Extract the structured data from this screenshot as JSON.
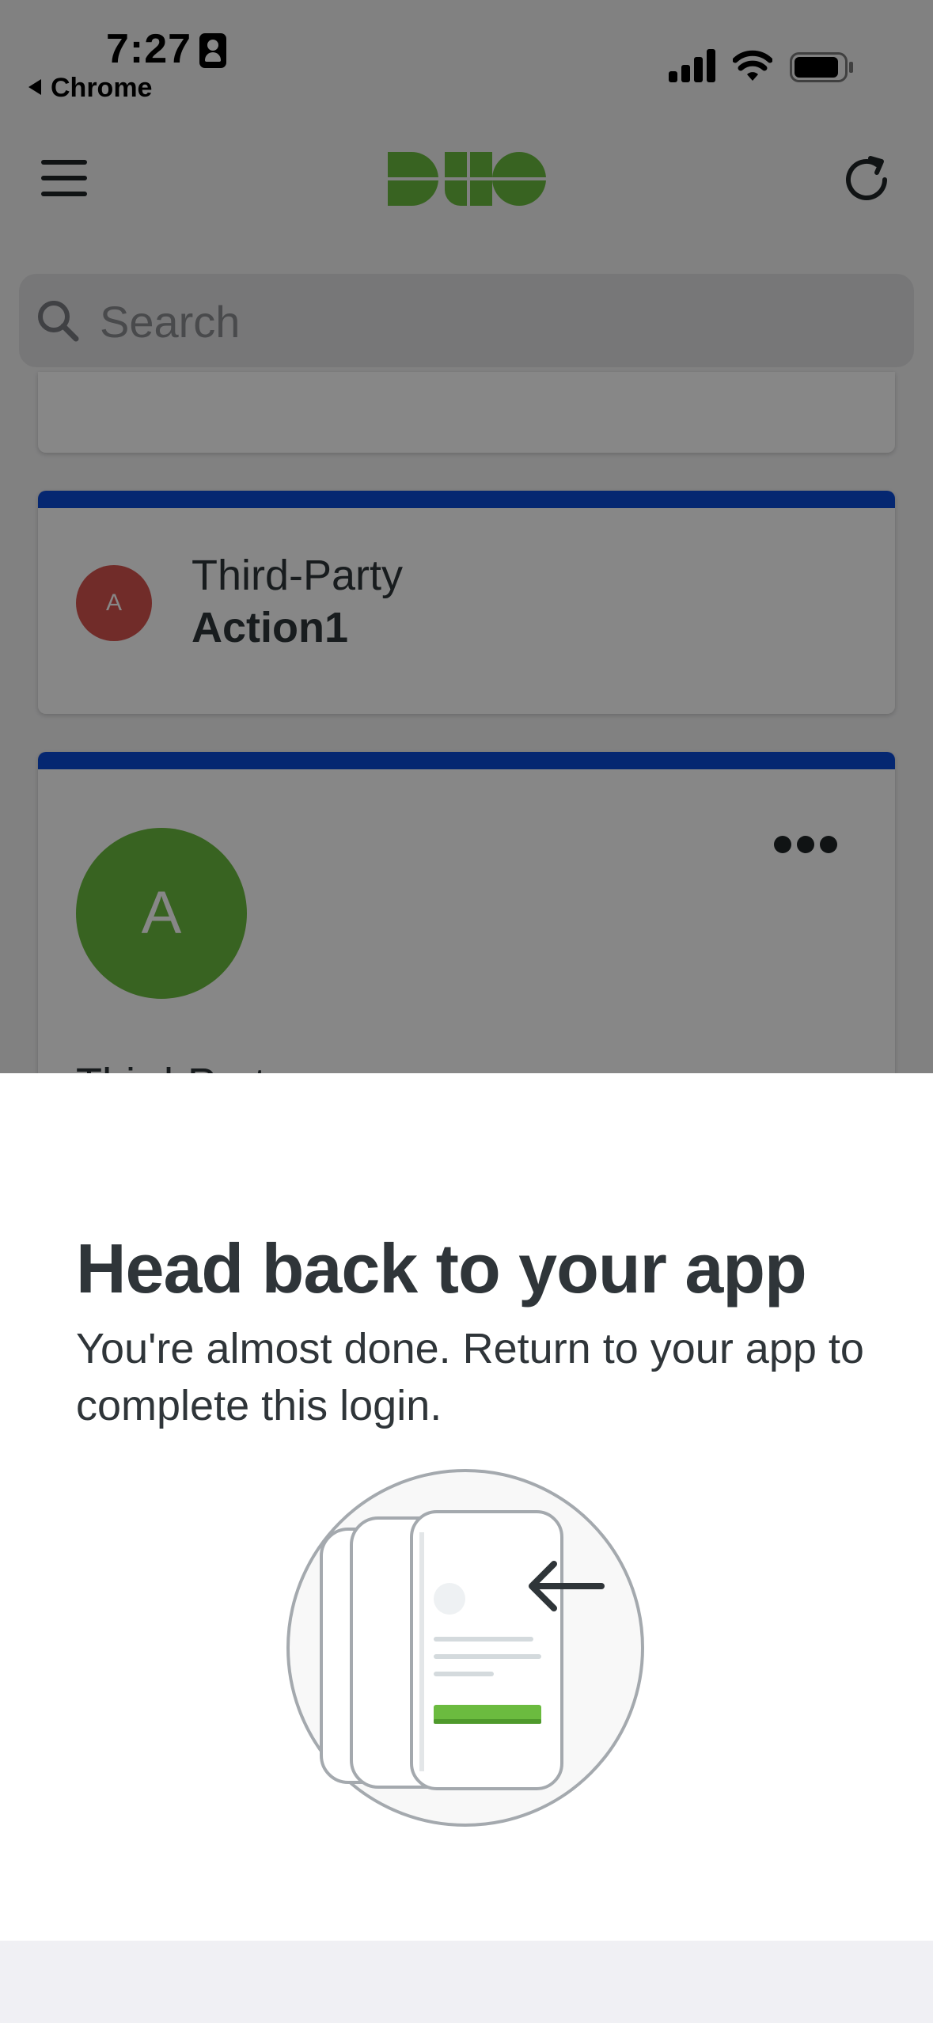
{
  "status_bar": {
    "time": "7:27",
    "back_app_label": "Chrome",
    "icons": [
      "focus-badge-icon",
      "cellular-signal-icon",
      "wifi-icon",
      "battery-icon"
    ]
  },
  "header": {
    "logo_text": "DUO",
    "menu_icon": "hamburger-menu-icon",
    "refresh_icon": "refresh-icon"
  },
  "search": {
    "placeholder": "Search"
  },
  "accounts": [
    {
      "avatar_letter": "A",
      "title": "Third-Party",
      "subtitle": "Action1",
      "avatar_color": "#d6544f"
    },
    {
      "avatar_letter": "A",
      "title": "Third-Part",
      "avatar_color": "#6bbb3f"
    }
  ],
  "colors": {
    "brand_green": "#6bbb3f",
    "card_stripe_blue": "#0a4bd6",
    "text_dark": "#2f3539"
  },
  "sheet": {
    "title": "Head back to your app",
    "message": "You're almost done. Return to your app to complete this login.",
    "illustration": "return-to-app-illustration"
  }
}
